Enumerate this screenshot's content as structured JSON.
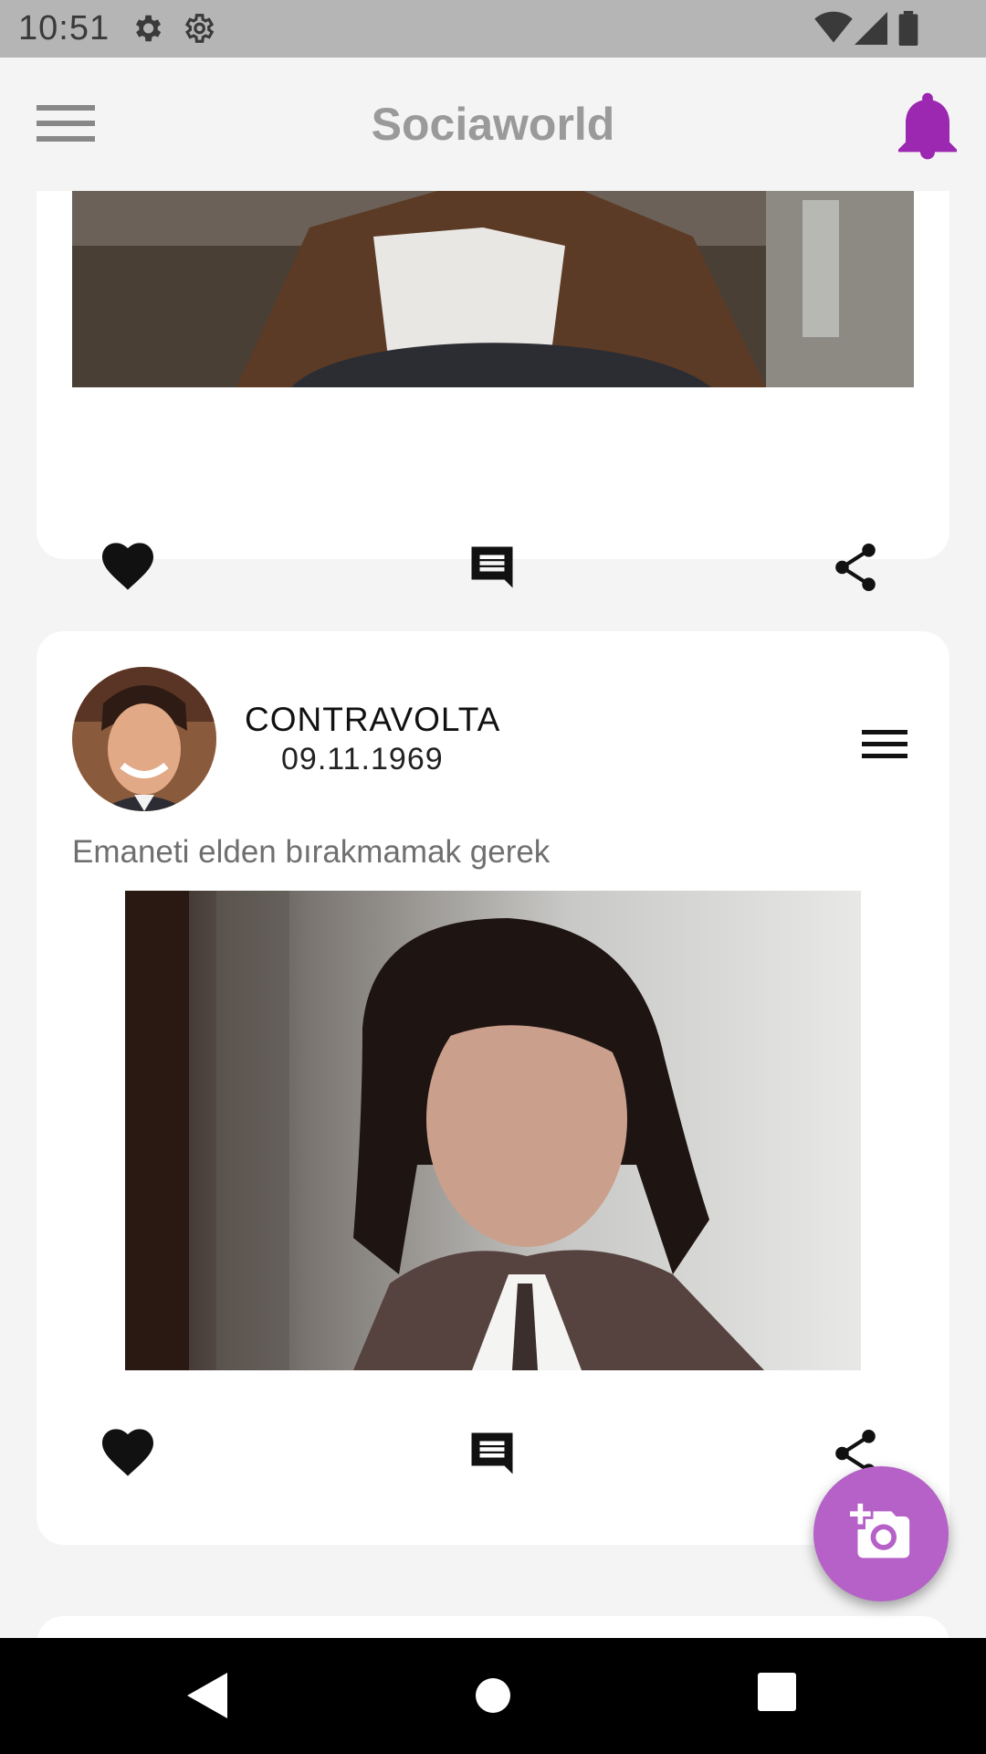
{
  "status_bar": {
    "time": "10:51"
  },
  "app_bar": {
    "title": "Sociaworld",
    "bell_color": "#9c27b0"
  },
  "posts": [
    {
      "actions": [
        "heart-icon",
        "comment-icon",
        "share-icon"
      ]
    },
    {
      "username": "CONTRAVOLTA",
      "date": "09.11.1969",
      "caption": "Emaneti elden bırakmamak gerek",
      "actions": [
        "heart-icon",
        "comment-icon",
        "share-icon"
      ]
    }
  ],
  "fab": {
    "icon": "add-photo-icon",
    "color": "#b561c7"
  },
  "nav_bar": {
    "buttons": [
      "back-icon",
      "home-icon",
      "recents-icon"
    ]
  }
}
